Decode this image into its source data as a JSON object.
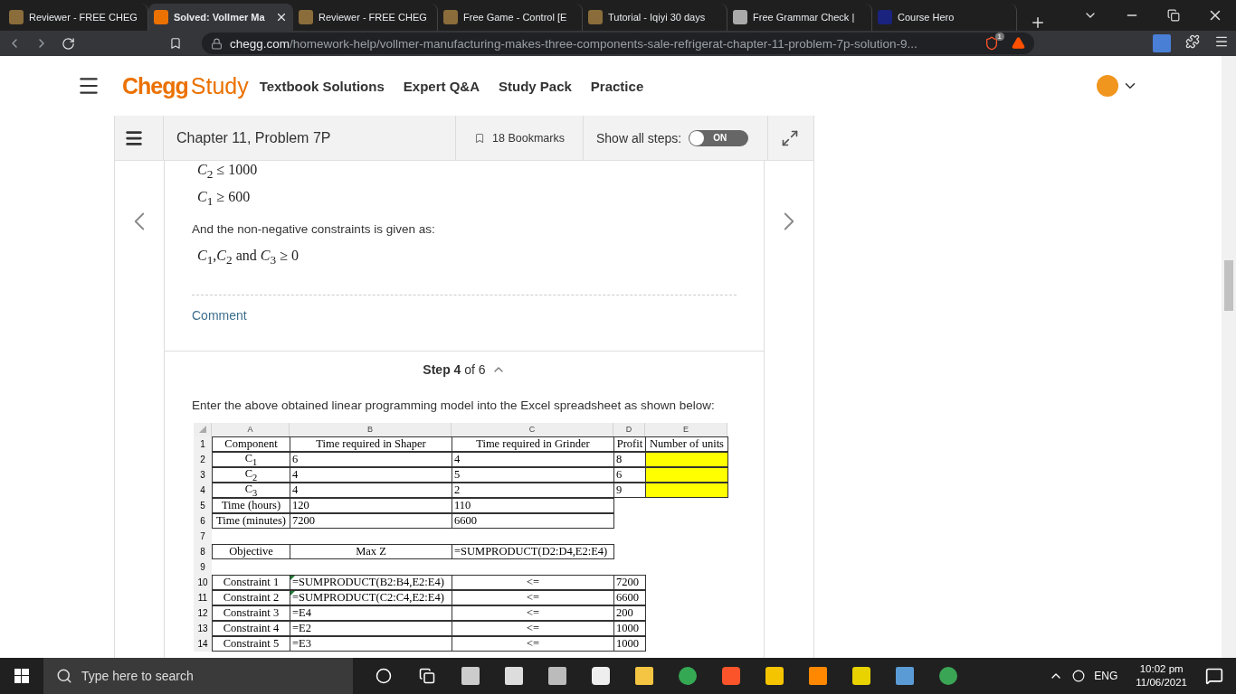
{
  "browser": {
    "tabs": [
      {
        "title": "Reviewer - FREE CHEG",
        "selected": false
      },
      {
        "title": "Solved: Vollmer Ma",
        "selected": true
      },
      {
        "title": "Reviewer - FREE CHEG",
        "selected": false
      },
      {
        "title": "Free Game - Control [E",
        "selected": false
      },
      {
        "title": "Tutorial - Iqiyi 30 days",
        "selected": false
      },
      {
        "title": "Free Grammar Check |",
        "selected": false
      },
      {
        "title": "Course Hero",
        "selected": false
      }
    ],
    "address": {
      "domain": "chegg.com",
      "path": "/homework-help/vollmer-manufacturing-makes-three-components-sale-refrigerat-chapter-11-problem-7p-solution-9..."
    },
    "shield_count": "1"
  },
  "header": {
    "brand": "Chegg",
    "product": "Study",
    "nav": [
      "Textbook Solutions",
      "Expert Q&A",
      "Study Pack",
      "Practice"
    ]
  },
  "toolbar": {
    "chapter_title": "Chapter 11, Problem 7P",
    "bookmarks": "18 Bookmarks",
    "show_all_steps": {
      "label": "Show all steps:",
      "on": true,
      "text": "ON"
    }
  },
  "step_content": {
    "math_lines": [
      "*C*$_{2}$ ≤ 1000",
      "*C*$_{1}$ ≥ 600"
    ],
    "text": "And the non-negative constraints is given as:",
    "final_math": "*C*$_{1}$,*C*$_{2}$ and *C*$_{3}$ ≥ 0",
    "comment": "Comment"
  },
  "next_step": {
    "heading": "**Step 4** of 6",
    "expanded": true,
    "text": "Enter the above obtained linear programming model into the Excel spreadsheet as shown below:",
    "spreadsheet": {
      "columns": [
        "A",
        "B",
        "C",
        "D",
        "E"
      ],
      "rows": [
        {
          "number": "1",
          "cells": [
            {
              "text": "Component"
            },
            {
              "text": "Time required in Shaper"
            },
            {
              "text": "Time required in Grinder"
            },
            {
              "text": "Profit"
            },
            {
              "text": "Number of units"
            }
          ]
        },
        {
          "number": "2",
          "cells": [
            {
              "text": "C$_{1}$"
            },
            {
              "text": "6"
            },
            {
              "text": "4"
            },
            {
              "text": "8"
            },
            {
              "highlighted": true
            }
          ]
        },
        {
          "number": "3",
          "cells": [
            {
              "text": "C$_{2}$"
            },
            {
              "text": "4"
            },
            {
              "text": "5"
            },
            {
              "text": "6"
            },
            {
              "highlighted": true
            }
          ]
        },
        {
          "number": "4",
          "cells": [
            {
              "text": "C$_{3}$"
            },
            {
              "text": "4"
            },
            {
              "text": "2"
            },
            {
              "text": "9"
            },
            {
              "highlighted": true
            }
          ]
        },
        {
          "number": "5",
          "cells": [
            {
              "text": "Time (hours)"
            },
            {
              "text": "120"
            },
            {
              "text": "110"
            }
          ]
        },
        {
          "number": "6",
          "cells": [
            {
              "text": "Time (minutes)"
            },
            {
              "text": "7200"
            },
            {
              "text": "6600"
            }
          ]
        },
        {
          "number": "7"
        },
        {
          "number": "8",
          "cells": [
            {
              "text": "Objective"
            },
            {
              "text": "Max Z",
              "centered": true
            },
            {
              "text": "=SUMPRODUCT(D2:D4,E2:E4)"
            }
          ]
        },
        {
          "number": "9"
        },
        {
          "number": "10",
          "cells": [
            {
              "text": "Constraint 1"
            },
            {
              "text": "=SUMPRODUCT(B2:B4,E2:E4)",
              "flagged": true
            },
            {
              "text": "<=",
              "centered": true
            },
            {
              "text": "7200"
            }
          ]
        },
        {
          "number": "11",
          "cells": [
            {
              "text": "Constraint 2"
            },
            {
              "text": "=SUMPRODUCT(C2:C4,E2:E4)",
              "flagged": true
            },
            {
              "text": "<=",
              "centered": true
            },
            {
              "text": "6600"
            }
          ]
        },
        {
          "number": "12",
          "cells": [
            {
              "text": "Constraint 3"
            },
            {
              "text": "=E4"
            },
            {
              "text": "<=",
              "centered": true
            },
            {
              "text": "200"
            }
          ]
        },
        {
          "number": "13",
          "cells": [
            {
              "text": "Constraint 4"
            },
            {
              "text": "=E2"
            },
            {
              "text": "<=",
              "centered": true
            },
            {
              "text": "1000"
            }
          ]
        },
        {
          "number": "14",
          "cells": [
            {
              "text": "Constraint 5"
            },
            {
              "text": "=E3"
            },
            {
              "text": "<=",
              "centered": true
            },
            {
              "text": "1000"
            }
          ]
        }
      ]
    }
  },
  "taskbar": {
    "search_placeholder": "Type here to search",
    "language": "ENG",
    "time": "10:02 pm",
    "date": "11/06/2021"
  }
}
